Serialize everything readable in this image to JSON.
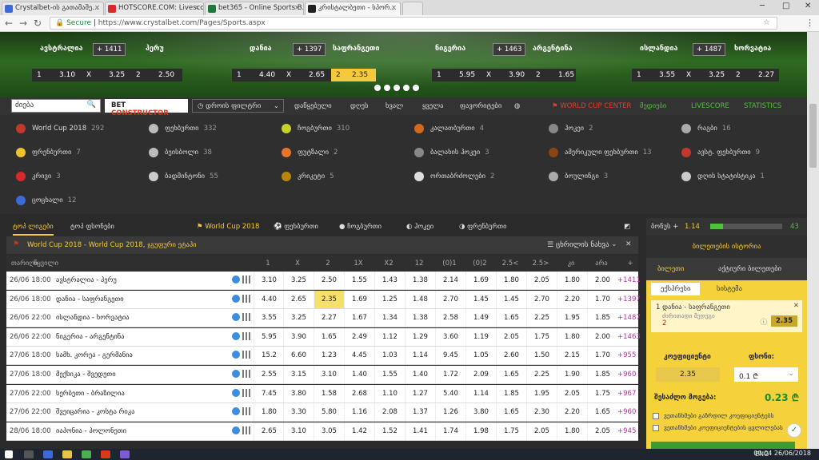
{
  "browser": {
    "tabs": [
      {
        "label": "Crystalbet-ის გათამაშე...",
        "color": "#3c6ad8"
      },
      {
        "label": "HOTSCORE.COM: Livesco...",
        "color": "#d82a2a"
      },
      {
        "label": "bet365 - Online Sports B...",
        "color": "#1f7a3a"
      },
      {
        "label": "კრისტალბეთი - სპორ...",
        "color": "#222"
      }
    ],
    "secure": "Secure",
    "url": "https://www.crystalbet.com/Pages/Sports.aspx"
  },
  "hero": {
    "matches": [
      {
        "home": "ავსტრალია",
        "away": "პერუ",
        "plus": "+ 1411",
        "o1": "3.10",
        "ox": "3.25",
        "o2": "2.50",
        "hl": ""
      },
      {
        "home": "დანია",
        "away": "საფრანგეთი",
        "plus": "+ 1397",
        "o1": "4.40",
        "ox": "2.65",
        "o2": "2.35",
        "hl": "2"
      },
      {
        "home": "ნიგერია",
        "away": "არგენტინა",
        "plus": "+ 1463",
        "o1": "5.95",
        "ox": "3.90",
        "o2": "1.65",
        "hl": ""
      },
      {
        "home": "ისლანდია",
        "away": "ხორვატია",
        "plus": "+ 1487",
        "o1": "3.55",
        "ox": "3.25",
        "o2": "2.27",
        "hl": ""
      }
    ],
    "labels": {
      "one": "1",
      "x": "X",
      "two": "2"
    }
  },
  "nav": {
    "search_placeholder": "ძიება",
    "betc_a": "BET ",
    "betc_b": "CONSTRUCTOR",
    "time_filter": "დროის ფილტრი",
    "items": [
      "დაწყებული",
      "დღეს",
      "ხვალ",
      "ყველა",
      "ფავორიტები"
    ],
    "worldcup": "WORLD CUP CENTER",
    "mid": "მედიები",
    "livescore": "LIVESCORE",
    "stats": "STATISTICS"
  },
  "sports": [
    {
      "name": "World Cup 2018",
      "count": "292",
      "c": "#c0392b"
    },
    {
      "name": "ფეხბურთი",
      "count": "332",
      "c": "#bbb"
    },
    {
      "name": "ჩოგბურთი",
      "count": "310",
      "c": "#c7d22a"
    },
    {
      "name": "კალათბურთი",
      "count": "4",
      "c": "#d2691e"
    },
    {
      "name": "ჰოკეი",
      "count": "2",
      "c": "#888"
    },
    {
      "name": "რაგბი",
      "count": "16",
      "c": "#aaa"
    },
    {
      "name": "ფრენბურთი",
      "count": "7",
      "c": "#f0c12e"
    },
    {
      "name": "ბეისბოლი",
      "count": "38",
      "c": "#bbb"
    },
    {
      "name": "ფუტზალი",
      "count": "2",
      "c": "#e8742a"
    },
    {
      "name": "ბალახის ჰოკეი",
      "count": "3",
      "c": "#888"
    },
    {
      "name": "ამერიკული ფეხბურთი",
      "count": "13",
      "c": "#8b4513"
    },
    {
      "name": "ავსტ. ფეხბურთი",
      "count": "9",
      "c": "#c0392b"
    },
    {
      "name": "კრივი",
      "count": "3",
      "c": "#d82a2a"
    },
    {
      "name": "ბადმინტონი",
      "count": "55",
      "c": "#ccc"
    },
    {
      "name": "კრიკეტი",
      "count": "5",
      "c": "#b8860b"
    },
    {
      "name": "ორთაბრძოლები",
      "count": "2",
      "c": "#ddd"
    },
    {
      "name": "ბოულინგი",
      "count": "3",
      "c": "#aaa"
    },
    {
      "name": "დღის სტატისტიკა",
      "count": "1",
      "c": "#ccc"
    },
    {
      "name": "ცოცხალი",
      "count": "12",
      "c": "#3c6ad8"
    }
  ],
  "maintabs": [
    "ტოპ ლიგები",
    "ტოპ ფსონები",
    "World Cup 2018",
    "ფეხბურთი",
    "ჩოგბურთი",
    "ჰოკეი",
    "ფრენბურთი"
  ],
  "league": {
    "title": "World Cup 2018 - World Cup 2018, ჯგუფური ეტაპი",
    "more": "ცხრილის ნახვა"
  },
  "columns": {
    "date": "თარიღი",
    "event": "წყვილი",
    "odds": [
      "1",
      "X",
      "2",
      "1X",
      "X2",
      "12",
      "(0)1",
      "(0)2",
      "2.5<",
      "2.5>",
      "კი",
      "არა",
      "+"
    ]
  },
  "rows": [
    {
      "date": "26/06 18:00",
      "name": "ავსტრალია - პერუ",
      "odds": [
        "3.10",
        "3.25",
        "2.50",
        "1.55",
        "1.43",
        "1.38",
        "2.14",
        "1.69",
        "1.80",
        "2.05",
        "1.80",
        "2.00"
      ],
      "more": "+1411",
      "hl": -1
    },
    {
      "date": "26/06 18:00",
      "name": "დანია - საფრანგეთი",
      "odds": [
        "4.40",
        "2.65",
        "2.35",
        "1.69",
        "1.25",
        "1.48",
        "2.70",
        "1.45",
        "1.45",
        "2.70",
        "2.20",
        "1.70"
      ],
      "more": "+1397",
      "hl": 2
    },
    {
      "date": "26/06 22:00",
      "name": "ისლანდია - ხორვატია",
      "odds": [
        "3.55",
        "3.25",
        "2.27",
        "1.67",
        "1.34",
        "1.38",
        "2.58",
        "1.49",
        "1.65",
        "2.25",
        "1.95",
        "1.85"
      ],
      "more": "+1487",
      "hl": -1
    },
    {
      "date": "26/06 22:00",
      "name": "ნიგერია - არგენტინა",
      "odds": [
        "5.95",
        "3.90",
        "1.65",
        "2.49",
        "1.12",
        "1.29",
        "3.60",
        "1.19",
        "2.05",
        "1.75",
        "1.80",
        "2.00"
      ],
      "more": "+1463",
      "hl": -1
    },
    {
      "date": "27/06 18:00",
      "name": "სამხ. კორეა - გერმანია",
      "odds": [
        "15.2",
        "6.60",
        "1.23",
        "4.45",
        "1.03",
        "1.14",
        "9.45",
        "1.05",
        "2.60",
        "1.50",
        "2.15",
        "1.70"
      ],
      "more": "+955",
      "hl": -1
    },
    {
      "date": "27/06 18:00",
      "name": "მექსიკა - შვედეთი",
      "odds": [
        "2.55",
        "3.15",
        "3.10",
        "1.40",
        "1.55",
        "1.40",
        "1.72",
        "2.09",
        "1.65",
        "2.25",
        "1.90",
        "1.85"
      ],
      "more": "+960",
      "hl": -1
    },
    {
      "date": "27/06 22:00",
      "name": "სერბეთი - ბრაზილია",
      "odds": [
        "7.45",
        "3.80",
        "1.58",
        "2.68",
        "1.10",
        "1.27",
        "5.40",
        "1.14",
        "1.85",
        "1.95",
        "2.05",
        "1.75"
      ],
      "more": "+967",
      "hl": -1
    },
    {
      "date": "27/06 22:00",
      "name": "შვეიცარია - კოსტა რიკა",
      "odds": [
        "1.80",
        "3.30",
        "5.80",
        "1.16",
        "2.08",
        "1.37",
        "1.26",
        "3.80",
        "1.65",
        "2.30",
        "2.20",
        "1.65"
      ],
      "more": "+960",
      "hl": -1
    },
    {
      "date": "28/06 18:00",
      "name": "იაპონია - პოლონეთი",
      "odds": [
        "2.65",
        "3.10",
        "3.05",
        "1.42",
        "1.52",
        "1.41",
        "1.74",
        "1.98",
        "1.75",
        "2.05",
        "1.80",
        "2.05"
      ],
      "more": "+945",
      "hl": -1
    }
  ],
  "right": {
    "bonus": "ბონუს +",
    "bonus_val": "1.14",
    "bonus_max": "43",
    "bonus_fill": 0.18,
    "history": "ბილეთების ისტორია",
    "tab1": "ბილეთი",
    "tab2": "აქტიური ბილეთები",
    "stab1": "ექსპრესი",
    "stab2": "სისტემა",
    "bet_line": "1  დანია - საფრანგეთი",
    "bet_sub": "ძირითადი შედეგი",
    "bet_out": "2",
    "bet_odd": "2.35",
    "coef_label": "კოეფიციენტი",
    "stake_label": "ფსონი:",
    "coef": "2.35",
    "stake": "0.1",
    "win_label": "შესაძლო მოგება:",
    "win": "0.23 ₾",
    "c1": "ვეთანხმები გაზრდილ კოეფიციენტებს",
    "c2": "ვეთანხმები კოეფიციენტების ცვლილებას"
  },
  "taskbar": {
    "lang": "ENG",
    "time": "00:04",
    "date": "26/06/2018"
  }
}
